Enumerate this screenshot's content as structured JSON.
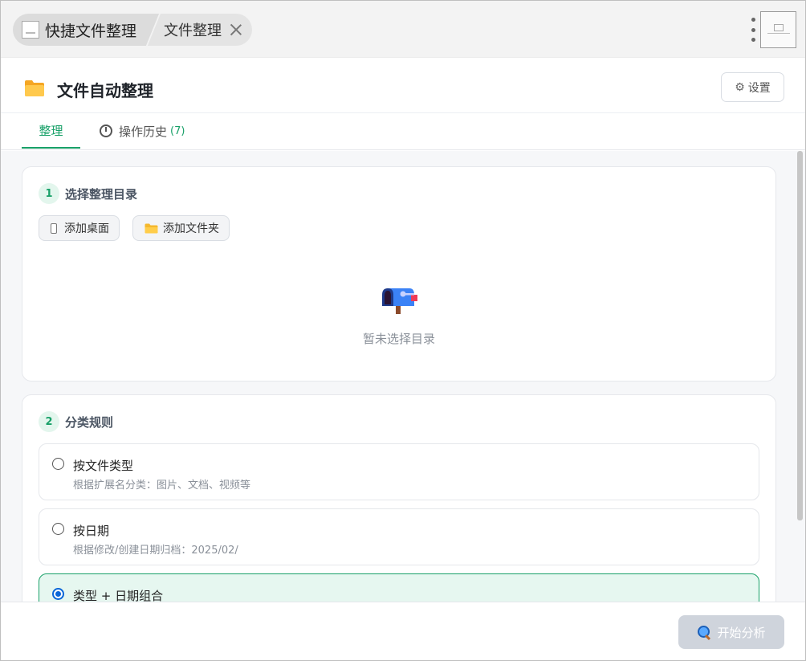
{
  "titlebar": {
    "app_title": "快捷文件整理",
    "tab_title": "文件整理"
  },
  "header": {
    "title": "文件自动整理",
    "settings_label": "设置",
    "settings_icon": "gear-icon"
  },
  "tabs": [
    {
      "label": "整理",
      "active": true
    },
    {
      "label": "操作历史",
      "count": "(7)",
      "icon": "clock-icon",
      "active": false
    }
  ],
  "step1": {
    "number": "1",
    "title": "选择整理目录",
    "add_desktop_label": "添加桌面",
    "add_folder_label": "添加文件夹",
    "empty_text": "暂未选择目录",
    "empty_icon": "mailbox-icon"
  },
  "step2": {
    "number": "2",
    "title": "分类规则",
    "options": [
      {
        "title": "按文件类型",
        "desc": "根据扩展名分类：图片、文档、视频等",
        "selected": false
      },
      {
        "title": "按日期",
        "desc": "根据修改/创建日期归档：2025/02/",
        "selected": false
      },
      {
        "title": "类型 + 日期组合",
        "desc": "",
        "selected": true
      }
    ]
  },
  "footer": {
    "analyze_label": "开始分析",
    "analyze_icon": "magnifier-icon"
  },
  "colors": {
    "accent": "#18a068",
    "radio_selected": "#0a66d8",
    "disabled_button": "#cfd4dc"
  }
}
